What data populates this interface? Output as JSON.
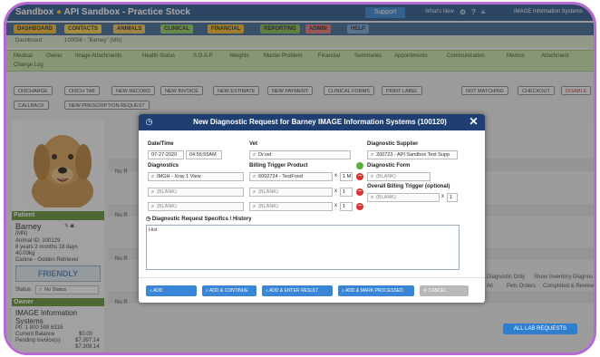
{
  "window": {
    "title_prefix": "Sandbox",
    "title_sep": "●",
    "title": "API Sandbox - Practice Stock",
    "support_label": "Support",
    "help_link": "What's New",
    "user_label": "IMAGE Information Systems"
  },
  "module_tabs": [
    {
      "label": "DASHBOARD",
      "color": "#f4b41a"
    },
    {
      "label": "CONTACTS",
      "color": "#f4d03f"
    },
    {
      "label": "ANIMALS",
      "color": "#f0c04a"
    },
    {
      "label": "CLINICAL",
      "color": "#8fc85a"
    },
    {
      "label": "FINANCIAL",
      "color": "#f4b41a"
    },
    {
      "label": "REPORTING",
      "color": "#7fb24a"
    },
    {
      "label": "ADMIN",
      "color": "#e07070"
    },
    {
      "label": "HELP",
      "color": "#6fa0d8"
    }
  ],
  "crumb": {
    "home": "Dashboard",
    "current": "100056 - \"Barney\" (MN)"
  },
  "nav_items": [
    "Medical",
    "Owner",
    "Image Attachments",
    "Health Status",
    "S.O.A.P.",
    "Weights",
    "Master Problem",
    "Financial",
    "Summaries",
    "Appointments",
    "Communication",
    "Memos",
    "Attachment",
    "Change Log"
  ],
  "action_buttons": [
    "DISCHARGE",
    "DISCH TAB",
    "NEW RECORD",
    "NEW INVOICE",
    "NEW ESTIMATE",
    "NEW PAYMENT",
    "CLINICAL FORMS",
    "PRINT LABEL",
    "NOT MATCHING",
    "CHECKOUT",
    "DISABLE",
    "CALLBACK",
    "NEW PRESCRIPTION REQUEST"
  ],
  "patient": {
    "header": "Patient",
    "name": "Barney",
    "sex": "(MN)",
    "id_line": "Animal ID: 100129",
    "age_line": "8 years 2 months 18 days",
    "weight_line": "40.03kg",
    "breed_line": "Canine - Golden Retriever",
    "friendly_label": "FRIENDLY",
    "status_label": "Status",
    "status_value": "No Status"
  },
  "owner": {
    "header": "Owner",
    "name": "IMAGE Information Systems",
    "phone": "Ph: 1 800 508 6318",
    "balance_label": "Current Balance",
    "balance_value": "$0.00",
    "pending_label": "Pending Invoice(s)",
    "pending_value": "$7,397.14",
    "total_value": "$7,309.14"
  },
  "background": {
    "no_rows": "No R",
    "lab_button": "ALL LAB REQUESTS",
    "checkbox_labels": [
      "Diagnostic Only",
      "Show Inventory Diagnos",
      "All",
      "Pets Orders",
      "Completed & Review"
    ]
  },
  "modal": {
    "title": "New Diagnostic Request for Barney IMAGE Information Systems (100120)",
    "date_label": "Date/Time",
    "date_value": "07-27-2020",
    "time_value": "04:56:55AM",
    "vet_label": "Vet",
    "vet_value": "Dr.vet",
    "supplier_label": "Diagnostic Supplier",
    "supplier_value": "200723 - API Sandbox Test Supp",
    "diagnostics_label": "Diagnostics",
    "diagnostics": [
      {
        "value": "IMGH - Xray 1 View",
        "placeholder": false
      },
      {
        "value": "(BLANK)",
        "placeholder": true
      },
      {
        "value": "(BLANK)",
        "placeholder": true
      }
    ],
    "billing_label": "Billing Trigger Product",
    "billing": [
      {
        "value": "6002724 - TestFood",
        "qty": "1 M",
        "placeholder": false
      },
      {
        "value": "(BLANK)",
        "qty": "1",
        "placeholder": true
      },
      {
        "value": "(BLANK)",
        "qty": "1",
        "placeholder": true
      }
    ],
    "form_label": "Diagnostic Form",
    "form_value": "(BLANK)",
    "overall_label": "Overall Billing Trigger (optional)",
    "overall_value": "(BLANK)",
    "overall_qty": "1",
    "qty_sep": "x",
    "specifics_label": "Diagnostic Request Specifics / History",
    "specifics_value": "Hist",
    "buttons": {
      "add": "ADD",
      "add_continue": "ADD & CONTINUE",
      "add_enter_result": "ADD & ENTER RESULT",
      "add_mark_processed": "ADD & MARK PROCESSED",
      "cancel": "CANCEL"
    }
  }
}
